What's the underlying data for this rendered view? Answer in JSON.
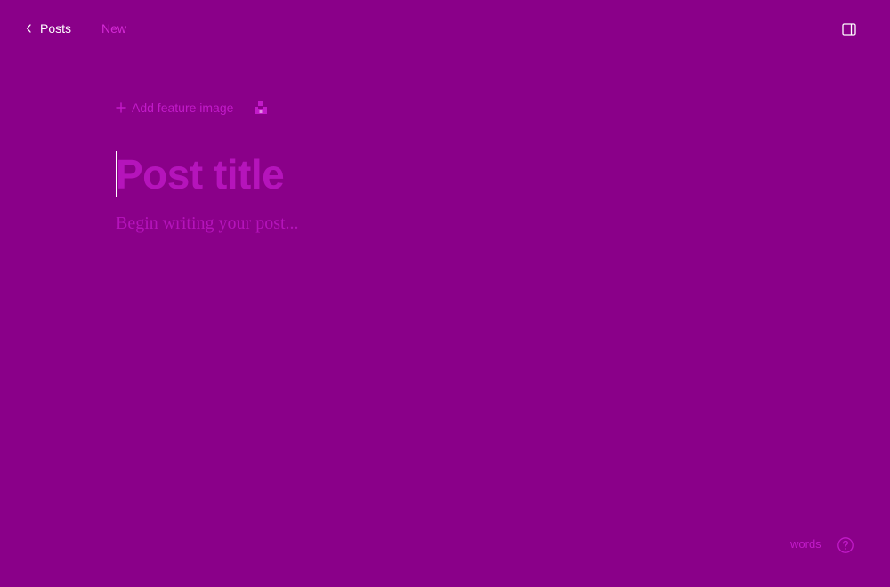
{
  "header": {
    "back_label": "Posts",
    "status": "New"
  },
  "editor": {
    "add_feature_image_label": "Add feature image",
    "title_placeholder": "Post title",
    "body_placeholder": "Begin writing your post..."
  },
  "footer": {
    "words_label": "words"
  },
  "colors": {
    "background": "#8a0089",
    "accent": "#d42ad6",
    "placeholder": "#b514bb",
    "text": "#ffffff"
  },
  "icons": {
    "back": "chevron-left-icon",
    "sidebar": "sidebar-toggle-icon",
    "add": "plus-icon",
    "unsplash": "unsplash-icon",
    "help": "help-circle-icon"
  }
}
